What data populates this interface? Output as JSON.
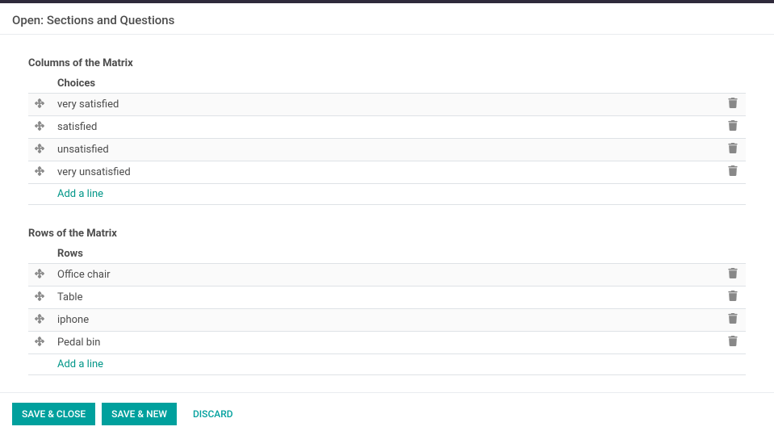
{
  "modal": {
    "title": "Open: Sections and Questions"
  },
  "columns_section": {
    "heading": "Columns of the Matrix",
    "header": "Choices",
    "items": [
      {
        "label": "very satisfied"
      },
      {
        "label": "satisfied"
      },
      {
        "label": "unsatisfied"
      },
      {
        "label": "very unsatisfied"
      }
    ],
    "add_line": "Add a line"
  },
  "rows_section": {
    "heading": "Rows of the Matrix",
    "header": "Rows",
    "items": [
      {
        "label": "Office chair"
      },
      {
        "label": "Table"
      },
      {
        "label": "iphone"
      },
      {
        "label": "Pedal bin"
      }
    ],
    "add_line": "Add a line"
  },
  "footer": {
    "save_close": "SAVE & CLOSE",
    "save_new": "SAVE & NEW",
    "discard": "DISCARD"
  }
}
